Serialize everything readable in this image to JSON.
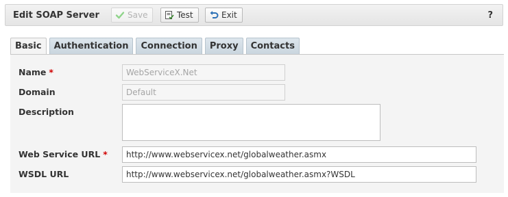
{
  "header": {
    "title": "Edit SOAP Server",
    "help_label": "?",
    "buttons": {
      "save": "Save",
      "test": "Test",
      "exit": "Exit"
    }
  },
  "tabs": [
    {
      "label": "Basic",
      "active": true
    },
    {
      "label": "Authentication",
      "active": false
    },
    {
      "label": "Connection",
      "active": false
    },
    {
      "label": "Proxy",
      "active": false
    },
    {
      "label": "Contacts",
      "active": false
    }
  ],
  "form": {
    "name": {
      "label": "Name",
      "required": "*",
      "value": "WebServiceX.Net"
    },
    "domain": {
      "label": "Domain",
      "value": "Default"
    },
    "description": {
      "label": "Description",
      "value": ""
    },
    "web_service_url": {
      "label": "Web Service URL",
      "required": "*",
      "value": "http://www.webservicex.net/globalweather.asmx"
    },
    "wsdl_url": {
      "label": "WSDL URL",
      "value": "http://www.webservicex.net/globalweather.asmx?WSDL"
    }
  },
  "colors": {
    "required": "#d00000",
    "tab_inactive": "#c9d5de",
    "panel": "#f4f4f4",
    "save_check": "#8fd48a",
    "exit_arrow": "#2a6fb5"
  },
  "icons": {
    "save": "check-icon",
    "test": "test-document-icon",
    "exit": "exit-arrow-icon"
  }
}
